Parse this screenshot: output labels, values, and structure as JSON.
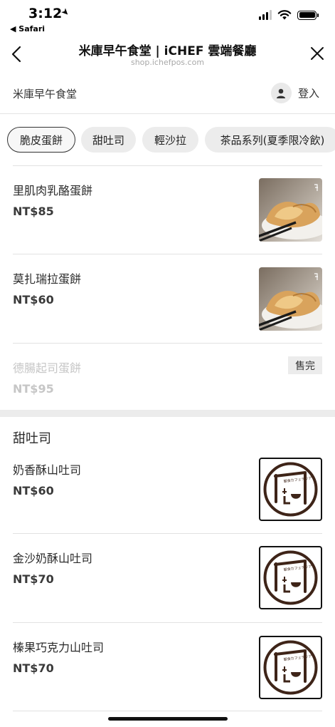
{
  "status": {
    "time": "3:12",
    "back_app": "◀ Safari"
  },
  "nav": {
    "title": "米庫早午食堂 | iCHEF 雲端餐廳",
    "url": "shop.ichefpos.com"
  },
  "shop": {
    "name": "米庫早午食堂",
    "login": "登入"
  },
  "tabs": [
    "脆皮蛋餅",
    "甜吐司",
    "輕沙拉",
    "茶品系列(夏季限冷飲)"
  ],
  "sections": [
    {
      "title": "",
      "items": [
        {
          "name": "里肌肉乳酪蛋餅",
          "price": "NT$85",
          "image": "crepe-photo"
        },
        {
          "name": "莫扎瑞拉蛋餅",
          "price": "NT$60",
          "image": "crepe-photo"
        },
        {
          "name": "德腸起司蛋餅",
          "price": "NT$95",
          "sold_out": "售完"
        }
      ]
    },
    {
      "title": "甜吐司",
      "items": [
        {
          "name": "奶香酥山吐司",
          "price": "NT$60",
          "image": "shop-logo"
        },
        {
          "name": "金沙奶酥山吐司",
          "price": "NT$70",
          "image": "shop-logo"
        },
        {
          "name": "榛果巧克力山吐司",
          "price": "NT$70",
          "image": "shop-logo"
        }
      ]
    }
  ],
  "logo_text": "朝食カフェテリア",
  "colors": {
    "accent": "#222222",
    "chip_bg": "#ececec",
    "sold_out_text": "#c6c6c6"
  }
}
